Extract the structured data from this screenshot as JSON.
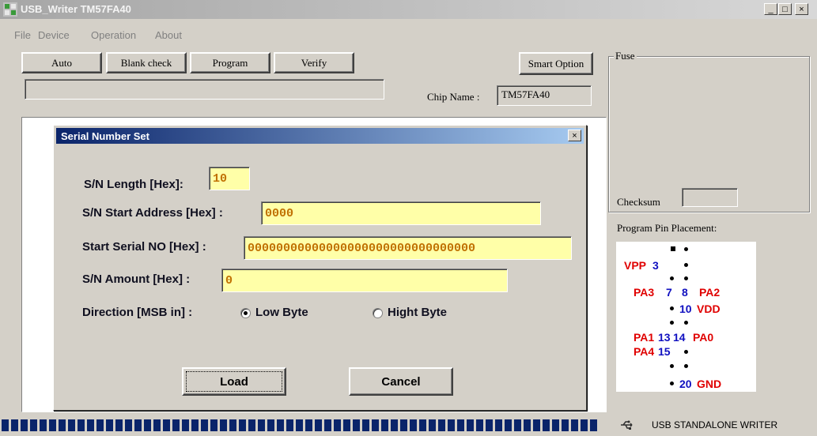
{
  "window": {
    "title": "USB_Writer  TM57FA40",
    "minimize": "_",
    "maximize": "□",
    "close": "×"
  },
  "menu": [
    "File",
    "Device",
    "Operation",
    "About"
  ],
  "toolbar": {
    "auto": "Auto",
    "blank_check": "Blank check",
    "program": "Program",
    "verify": "Verify",
    "smart_option": "Smart Option"
  },
  "chip": {
    "label": "Chip Name :",
    "value": "TM57FA40"
  },
  "fuse": {
    "legend": "Fuse",
    "checksum_label": "Checksum",
    "checksum_value": ""
  },
  "pins": {
    "title": "Program Pin Placement:",
    "labels": {
      "vpp": "VPP",
      "p3": "3",
      "pa3": "PA3",
      "p7": "7",
      "p8": "8",
      "pa2": "PA2",
      "p10": "10",
      "vdd": "VDD",
      "pa1": "PA1",
      "p13": "13",
      "p14": "14",
      "pa0": "PA0",
      "pa4": "PA4",
      "p15": "15",
      "p20": "20",
      "gnd": "GND"
    }
  },
  "dialog": {
    "title": "Serial Number Set",
    "close": "×",
    "sn_length_label": "S/N Length [Hex]:",
    "sn_length_value": "10",
    "sn_start_label": "S/N Start Address [Hex] :",
    "sn_start_value": "0000",
    "start_serial_label": "Start Serial NO [Hex] :",
    "start_serial_value": "00000000000000000000000000000000",
    "amount_label": "S/N Amount [Hex] :",
    "amount_value": "0",
    "direction_label": "Direction [MSB in] :",
    "low_byte": "Low Byte",
    "high_byte": "Hight Byte",
    "direction_selected": "Low Byte",
    "load": "Load",
    "cancel": "Cancel"
  },
  "status": {
    "progress": 1.0,
    "text": "USB STANDALONE WRITER"
  },
  "colors": {
    "dialog_title": "#0a246a",
    "input_bg": "#ffffa8",
    "pin_red": "#e00000",
    "pin_blue": "#1010c0",
    "progress": "#0a246a"
  },
  "icons": [
    "app-icon",
    "usb-icon",
    "radio-icon"
  ]
}
